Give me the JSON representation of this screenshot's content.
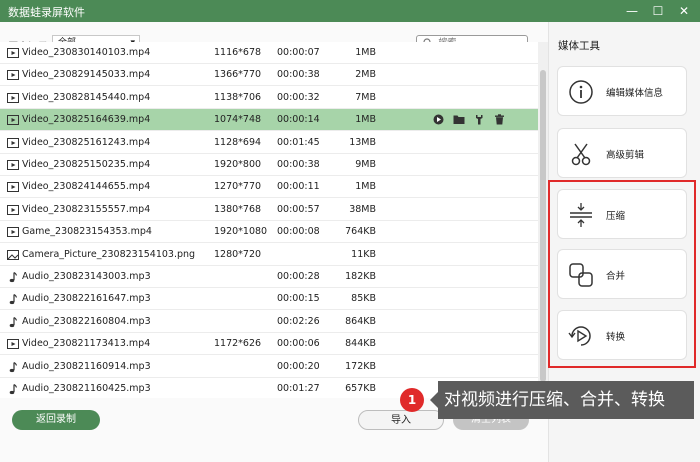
{
  "window": {
    "title": "数据蛙录屏软件",
    "minimize": "—",
    "maximize": "☐",
    "close": "✕"
  },
  "history": {
    "label": "历史记录",
    "filter": "全部"
  },
  "search": {
    "placeholder": "搜索"
  },
  "files": [
    {
      "icon": "video",
      "name": "Video_230830140103.mp4",
      "resolution": "1116*678",
      "duration": "00:00:07",
      "size": "1MB",
      "selected": false
    },
    {
      "icon": "video",
      "name": "Video_230829145033.mp4",
      "resolution": "1366*770",
      "duration": "00:00:38",
      "size": "2MB",
      "selected": false
    },
    {
      "icon": "video",
      "name": "Video_230828145440.mp4",
      "resolution": "1138*706",
      "duration": "00:00:32",
      "size": "7MB",
      "selected": false
    },
    {
      "icon": "video",
      "name": "Video_230825164639.mp4",
      "resolution": "1074*748",
      "duration": "00:00:14",
      "size": "1MB",
      "selected": true
    },
    {
      "icon": "video",
      "name": "Video_230825161243.mp4",
      "resolution": "1128*694",
      "duration": "00:01:45",
      "size": "13MB",
      "selected": false
    },
    {
      "icon": "video",
      "name": "Video_230825150235.mp4",
      "resolution": "1920*800",
      "duration": "00:00:38",
      "size": "9MB",
      "selected": false
    },
    {
      "icon": "video",
      "name": "Video_230824144655.mp4",
      "resolution": "1270*770",
      "duration": "00:00:11",
      "size": "1MB",
      "selected": false
    },
    {
      "icon": "video",
      "name": "Video_230823155557.mp4",
      "resolution": "1380*768",
      "duration": "00:00:57",
      "size": "38MB",
      "selected": false
    },
    {
      "icon": "video",
      "name": "Game_230823154353.mp4",
      "resolution": "1920*1080",
      "duration": "00:00:08",
      "size": "764KB",
      "selected": false
    },
    {
      "icon": "image",
      "name": "Camera_Picture_230823154103.png",
      "resolution": "1280*720",
      "duration": "",
      "size": "11KB",
      "selected": false
    },
    {
      "icon": "audio",
      "name": "Audio_230823143003.mp3",
      "resolution": "",
      "duration": "00:00:28",
      "size": "182KB",
      "selected": false
    },
    {
      "icon": "audio",
      "name": "Audio_230822161647.mp3",
      "resolution": "",
      "duration": "00:00:15",
      "size": "85KB",
      "selected": false
    },
    {
      "icon": "audio",
      "name": "Audio_230822160804.mp3",
      "resolution": "",
      "duration": "00:02:26",
      "size": "864KB",
      "selected": false
    },
    {
      "icon": "video",
      "name": "Video_230821173413.mp4",
      "resolution": "1172*626",
      "duration": "00:00:06",
      "size": "844KB",
      "selected": false
    },
    {
      "icon": "audio",
      "name": "Audio_230821160914.mp3",
      "resolution": "",
      "duration": "00:00:20",
      "size": "172KB",
      "selected": false
    },
    {
      "icon": "audio",
      "name": "Audio_230821160425.mp3",
      "resolution": "",
      "duration": "00:01:27",
      "size": "657KB",
      "selected": false
    }
  ],
  "buttons": {
    "back": "返回录制",
    "import": "导入",
    "clear": "清空列表"
  },
  "media_tools": {
    "title": "媒体工具",
    "items": [
      {
        "icon": "info",
        "label": "编辑媒体信息"
      },
      {
        "icon": "scissors",
        "label": "高级剪辑"
      },
      {
        "icon": "compress",
        "label": "压缩"
      },
      {
        "icon": "merge",
        "label": "合并"
      },
      {
        "icon": "convert",
        "label": "转换"
      }
    ]
  },
  "annotation": {
    "badge": "1",
    "text": "对视频进行压缩、合并、转换"
  },
  "colors": {
    "brand": "#4c8a56",
    "selected_row": "#a7d4a9",
    "highlight": "#e02a2a"
  }
}
